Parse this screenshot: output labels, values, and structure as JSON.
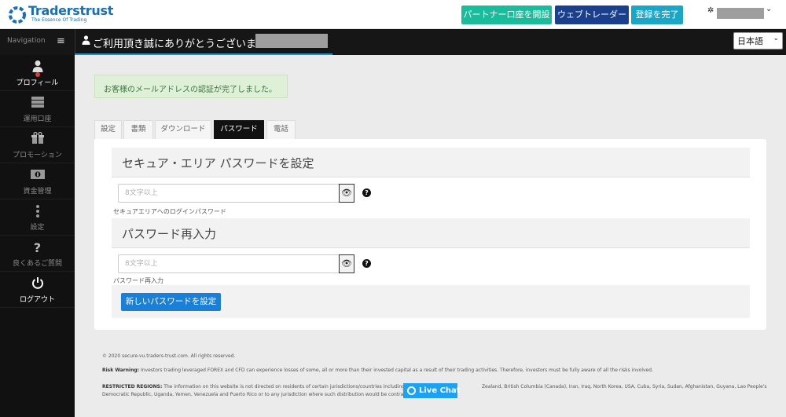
{
  "header": {
    "logo_name": "Traderstrust",
    "logo_tagline": "The Essence Of Trading",
    "btn_partner": "パートナー口座を開設",
    "btn_webtrader": "ウェブトレーダー",
    "btn_register": "登録を完了",
    "user_caret": "⌄"
  },
  "navbar": {
    "nav_label": "Navigation",
    "hamburger": "≡",
    "welcome": "ご利用頂き誠にありがとうございます",
    "lang": "日本語"
  },
  "sidebar": {
    "items": [
      {
        "icon": "person-icon",
        "glyph": "👤",
        "label": "プロフィール"
      },
      {
        "icon": "server-icon",
        "glyph": "☰",
        "label": "運用口座"
      },
      {
        "icon": "gift-icon",
        "glyph": "🎁",
        "label": "プロモーション"
      },
      {
        "icon": "money-icon",
        "glyph": "💵",
        "label": "資金管理"
      },
      {
        "icon": "more-icon",
        "glyph": "⋮",
        "label": "設定"
      },
      {
        "icon": "question-icon",
        "glyph": "?",
        "label": "良くあるご質問"
      },
      {
        "icon": "power-icon",
        "glyph": "⏻",
        "label": "ログアウト"
      }
    ]
  },
  "alert": {
    "message": "お客様のメールアドレスの認証が完了しました。"
  },
  "tabs": [
    "設定",
    "書類",
    "ダウンロード",
    "パスワード",
    "電話"
  ],
  "password_form": {
    "section1_title": "セキュア・エリア パスワードを設定",
    "field1_placeholder": "8文字以上",
    "field1_hint": "セキュアエリアへのログインパスワード",
    "section2_title": "パスワード再入力",
    "field2_placeholder": "8文字以上",
    "field2_hint": "パスワード再入力",
    "submit_label": "新しいパスワードを設定",
    "help_glyph": "?"
  },
  "footer": {
    "copyright": "© 2020 secure-vu.traders-trust.com. All rights reserved.",
    "risk_title": "Risk Warning:",
    "risk_text": " Investors trading leveraged FOREX and CFD can experience losses of some, all or more than their invested capital as a result of their trading activities. Therefore, investors must be fully aware of all the risks involved.",
    "restricted_title": "RESTRICTED REGIONS:",
    "restricted_text": " The information on this website is not directed on residents of certain jurisdictions/countries including but not                                       Zealand, British Columbia (Canada), Iran, Iraq, North Korea, USA, Cuba, Syria, Sudan, Afghanistan, Guyana, Lao People's Democratic Republic, Uganda, Yemen, Venezuela and Puerto Rico or to any jurisdiction where such distribution would be contrary to local laws and",
    "live_chat": "Live Chat"
  },
  "colors": {
    "partner": "#1abc9c",
    "webtrader": "#1a3f8c",
    "register": "#1aa7c7",
    "accent": "#1a7fd6"
  }
}
